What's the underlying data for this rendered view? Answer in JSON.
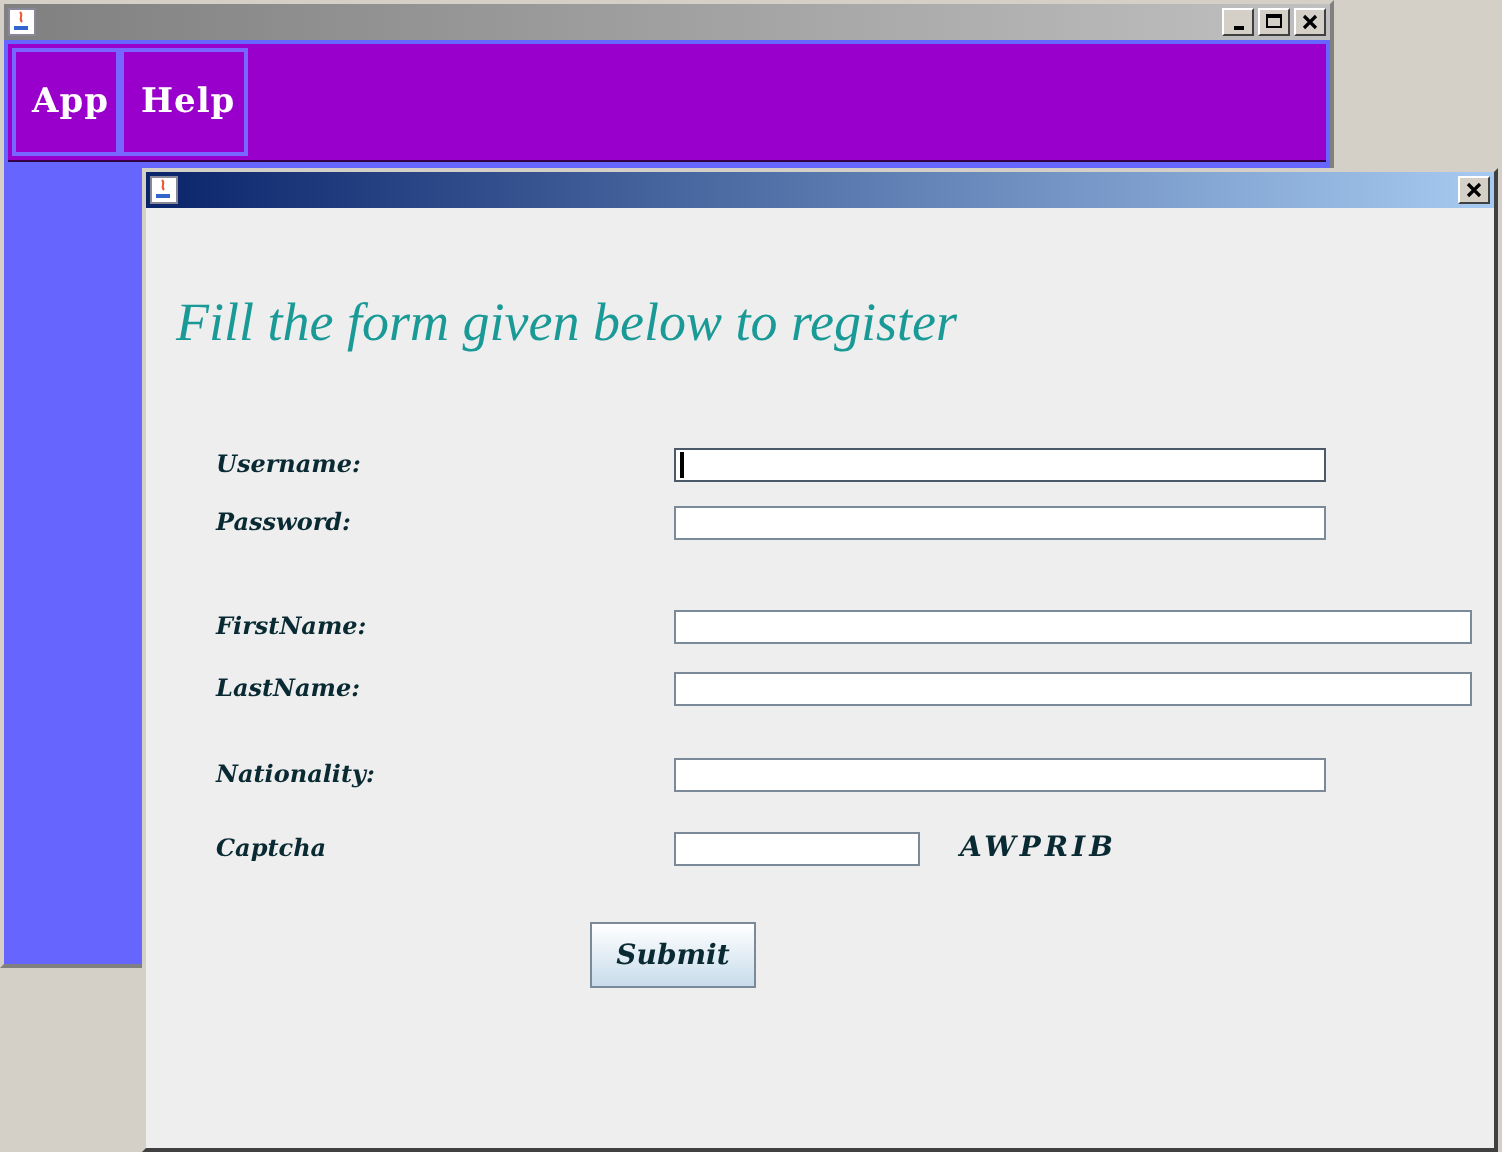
{
  "main_window": {
    "menus": [
      {
        "label": "App"
      },
      {
        "label": "Help"
      }
    ]
  },
  "dialog": {
    "heading": "Fill the form given below to register",
    "fields": [
      {
        "label": "Username:",
        "kind": "text",
        "focused": true
      },
      {
        "label": "Password:",
        "kind": "password",
        "focused": false
      },
      {
        "label": "FirstName:",
        "kind": "text",
        "focused": false
      },
      {
        "label": "LastName:",
        "kind": "text",
        "focused": false
      },
      {
        "label": "Nationality:",
        "kind": "text",
        "focused": false
      },
      {
        "label": "Captcha",
        "kind": "captcha",
        "focused": false,
        "code": "AWPRIB"
      }
    ],
    "submit": "Submit"
  }
}
